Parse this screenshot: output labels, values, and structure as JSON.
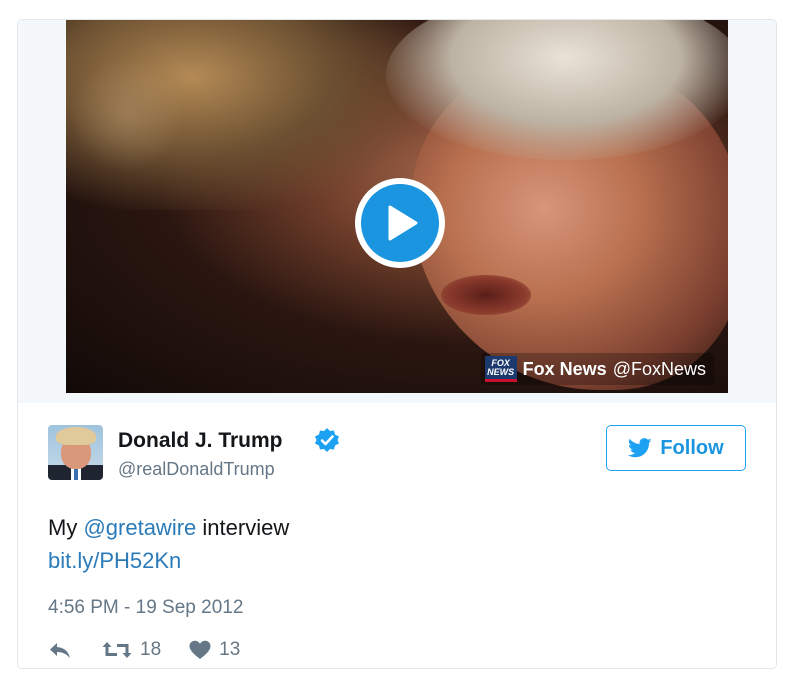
{
  "media": {
    "attribution_name": "Fox News",
    "attribution_handle": "@FoxNews",
    "logo_text_top": "FOX",
    "logo_text_bottom": "NEWS"
  },
  "author": {
    "name": "Donald J. Trump",
    "handle": "@realDonaldTrump",
    "verified": true
  },
  "follow_button": {
    "label": "Follow"
  },
  "tweet": {
    "text_before": "My ",
    "mention": "@gretawire",
    "text_after": " interview",
    "link": "bit.ly/PH52Kn",
    "timestamp": "4:56 PM - 19 Sep 2012"
  },
  "stats": {
    "retweets": "18",
    "likes": "13"
  },
  "icons": {
    "play": "play-icon",
    "verified": "verified-badge-icon",
    "twitter_bird": "twitter-bird-icon",
    "reply": "reply-icon",
    "retweet": "retweet-icon",
    "like": "heart-icon"
  },
  "colors": {
    "accent": "#1b95e0",
    "link": "#2b7bb9",
    "secondary_text": "#657786",
    "border": "#e1e8ed"
  }
}
